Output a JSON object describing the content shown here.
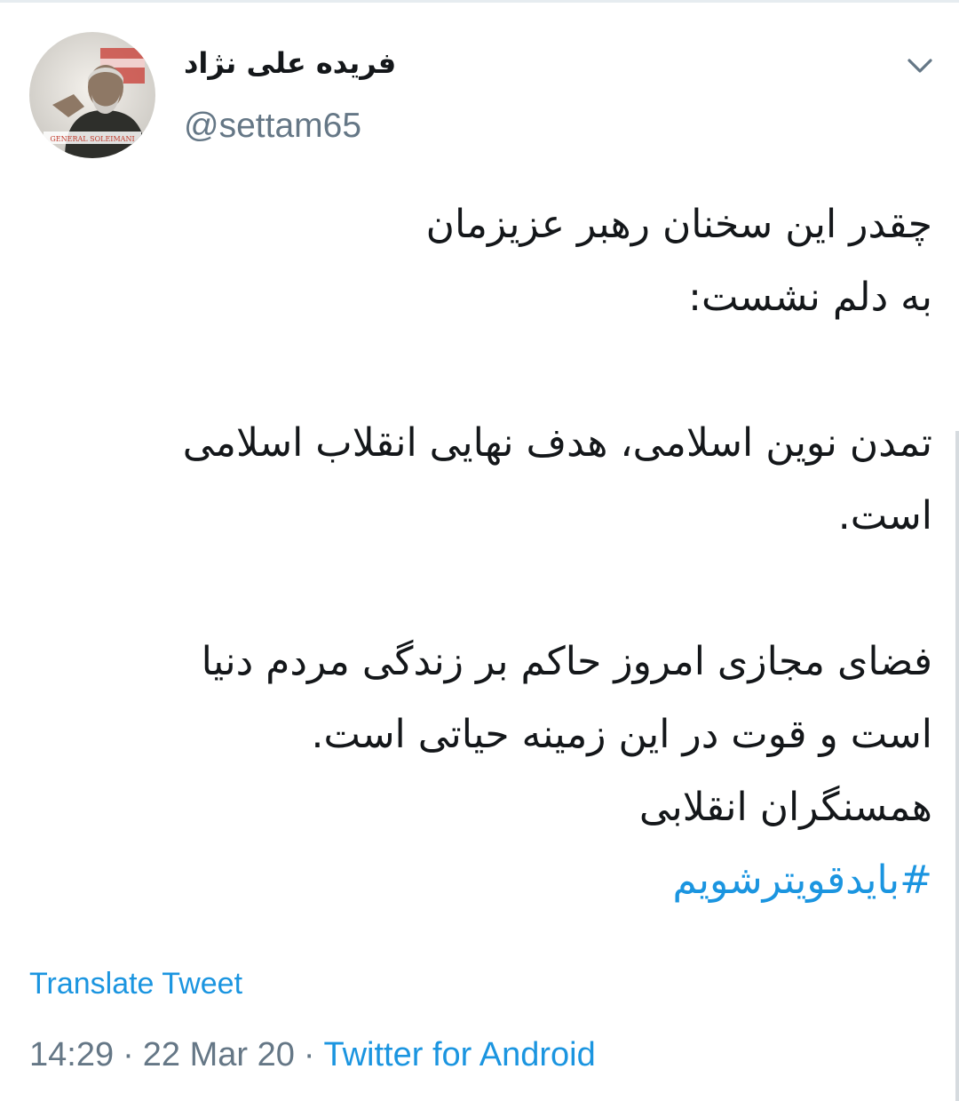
{
  "tweet": {
    "author": {
      "display_name": "فریده علی نژاد",
      "handle": "@settam65",
      "avatar_caption": "GENERAL SOLEIMANI"
    },
    "body_lines": [
      "چقدر این سخنان رهبر عزیزمان",
      "به دلم نشست:",
      "",
      "تمدن نوین اسلامی، هدف نهایی انقلاب اسلامی",
      "است.",
      "",
      "فضای مجازی امروز حاکم بر زندگی مردم دنیا",
      "است و قوت در این زمینه حیاتی است.",
      "همسنگران انقلابی"
    ],
    "hashtag": "#بایدقویترشویم",
    "translate_label": "Translate Tweet",
    "time": "14:29",
    "separator": "·",
    "date": "22 Mar 20",
    "source": "Twitter for Android",
    "menu_icon": "chevron-down-icon"
  },
  "colors": {
    "text_primary": "#14171a",
    "text_secondary": "#657786",
    "link": "#1b95e0"
  }
}
